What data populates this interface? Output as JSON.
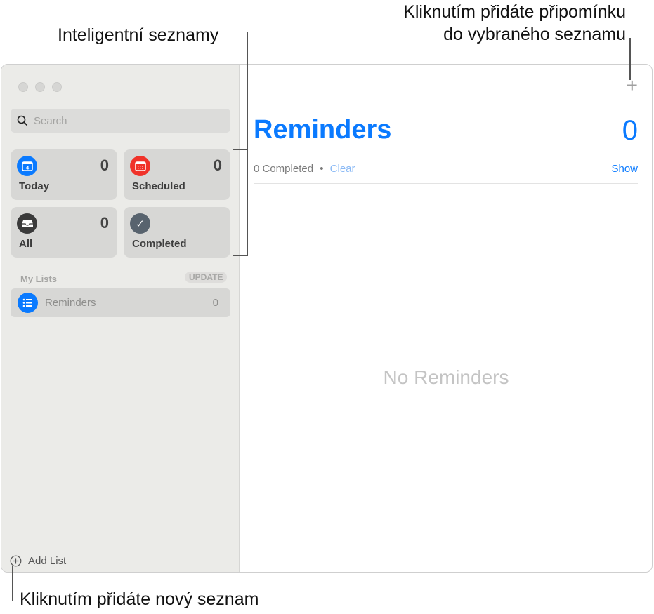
{
  "callouts": {
    "smart_lists": "Inteligentní seznamy",
    "add_reminder_line1": "Kliknutím přidáte připomínku",
    "add_reminder_line2": "do vybraného seznamu",
    "add_list": "Kliknutím přidáte nový seznam"
  },
  "sidebar": {
    "search_placeholder": "Search",
    "tiles": [
      {
        "label": "Today",
        "count": "0",
        "color": "#0a7aff"
      },
      {
        "label": "Scheduled",
        "count": "0",
        "color": "#f0332a"
      },
      {
        "label": "All",
        "count": "0",
        "color": "#3a3a3a"
      },
      {
        "label": "Completed",
        "count": "",
        "color": "#58636e"
      }
    ],
    "my_lists_header": "My Lists",
    "update_badge": "UPDATE",
    "lists": [
      {
        "label": "Reminders",
        "count": "0",
        "color": "#0a7aff"
      }
    ],
    "add_list": "Add List"
  },
  "main": {
    "title": "Reminders",
    "count": "0",
    "completed": "0 Completed",
    "bullet": "•",
    "clear": "Clear",
    "show": "Show",
    "empty": "No Reminders",
    "add_icon": "+"
  },
  "colors": {
    "accent": "#0a7aff"
  }
}
